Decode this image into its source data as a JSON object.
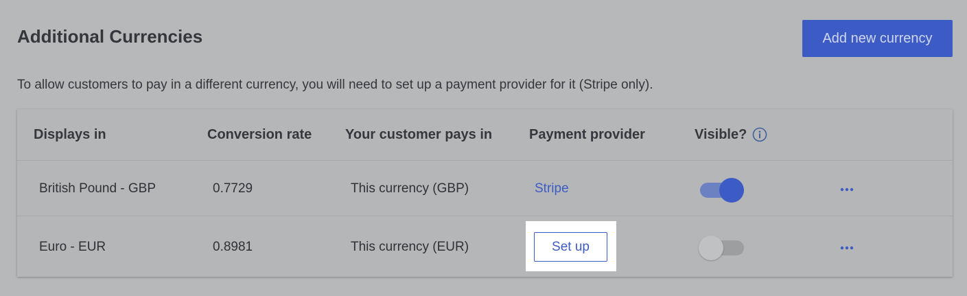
{
  "page": {
    "title": "Additional Currencies",
    "add_button": "Add new currency",
    "description": "To allow customers to pay in a different currency, you will need to set up a payment provider for it (Stripe only)."
  },
  "table": {
    "headers": [
      "Displays in",
      "Conversion rate",
      "Your customer pays in",
      "Payment provider",
      "Visible?"
    ],
    "rows": [
      {
        "displays_in": "British Pound - GBP",
        "rate": "0.7729",
        "pays_in": "This currency (GBP)",
        "provider": "Stripe",
        "visible": true
      },
      {
        "displays_in": "Euro - EUR",
        "rate": "0.8981",
        "pays_in": "This currency (EUR)",
        "provider": "Set up",
        "visible": false
      }
    ]
  },
  "icons": {
    "visible_info": "info-icon",
    "row_actions": "more-horizontal-icon"
  },
  "colors": {
    "accent": "#3d5bc4",
    "background": "#b7b8ba"
  }
}
